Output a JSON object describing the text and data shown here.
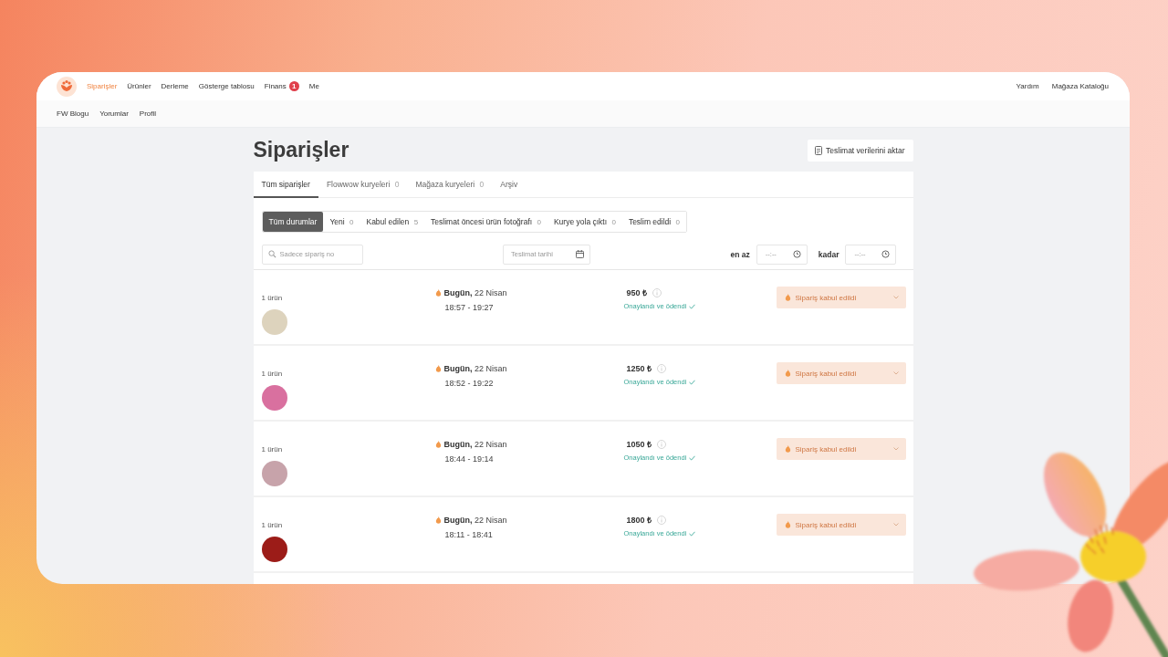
{
  "nav": {
    "items": [
      {
        "label": "Siparişler",
        "selected": true
      },
      {
        "label": "Ürünler",
        "selected": false
      },
      {
        "label": "Derleme",
        "selected": false
      },
      {
        "label": "Gösterge tablosu",
        "selected": false
      },
      {
        "label": "Finans",
        "selected": false,
        "badge": "1"
      },
      {
        "label": "Me",
        "selected": false
      }
    ],
    "links": [
      "Yardım",
      "Mağaza Kataloğu"
    ]
  },
  "subnav": {
    "items": [
      "FW Blogu",
      "Yorumlar",
      "Profil"
    ]
  },
  "header": {
    "title": "Siparişler",
    "export_button": "Teslimat verilerini aktar"
  },
  "tabs": [
    {
      "label": "Tüm siparişler",
      "selected": true
    },
    {
      "label": "Flowwow kuryeleri",
      "count": "0",
      "selected": false
    },
    {
      "label": "Mağaza kuryeleri",
      "count": "0",
      "selected": false
    },
    {
      "label": "Arşiv",
      "selected": false
    }
  ],
  "status_filters": [
    {
      "label": "Tüm durumlar",
      "selected": true
    },
    {
      "label": "Yeni",
      "count": "0",
      "selected": false
    },
    {
      "label": "Kabul edilen",
      "count": "5",
      "selected": false
    },
    {
      "label": "Teslimat öncesi ürün fotoğrafı",
      "count": "0",
      "selected": false
    },
    {
      "label": "Kurye yola çıktı",
      "count": "0",
      "selected": false
    },
    {
      "label": "Teslim edildi",
      "count": "0",
      "selected": false
    }
  ],
  "filters": {
    "search": {
      "placeholder": "Sadece sipariş no"
    },
    "date": {
      "placeholder": "Teslimat tarihi"
    },
    "time_from": {
      "label": "en az",
      "placeholder": "--:--"
    },
    "time_to": {
      "label": "kadar",
      "placeholder": "--:--"
    }
  },
  "orders": [
    {
      "items": "1 ürün",
      "delivery_day": "**Bugün,** 22 Nisan",
      "time": "18:57 - 19:27",
      "price": "950 ₺",
      "payment": "Onaylandı ve ödendi",
      "status": "Sipariş kabul edildi"
    },
    {
      "items": "1 ürün",
      "delivery_day": "**Bugün,** 22 Nisan",
      "time": "18:52 - 19:22",
      "price": "1250 ₺",
      "payment": "Onaylandı ve ödendi",
      "status": "Sipariş kabul edildi"
    },
    {
      "items": "1 ürün",
      "delivery_day": "**Bugün,** 22 Nisan",
      "time": "18:44 - 19:14",
      "price": "1050 ₺",
      "payment": "Onaylandı ve ödendi",
      "status": "Sipariş kabul edildi"
    },
    {
      "items": "1 ürün",
      "delivery_day": "**Bugün,** 22 Nisan",
      "time": "18:11 - 18:41",
      "price": "1800 ₺",
      "payment": "Onaylandı ve ödendi",
      "status": "Sipariş kabul edildi"
    }
  ]
}
